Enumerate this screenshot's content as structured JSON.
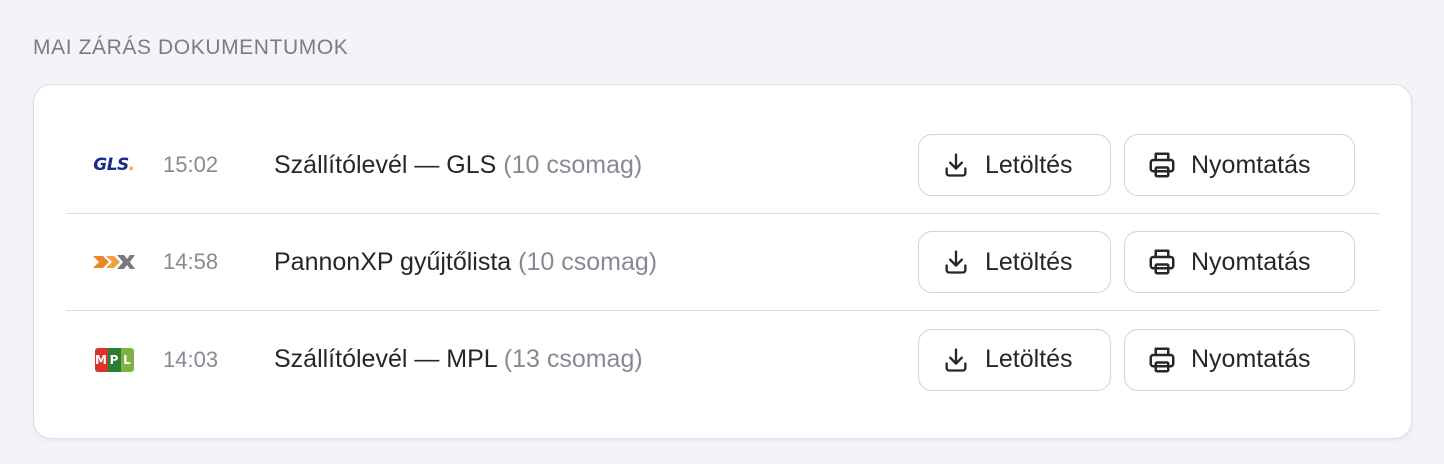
{
  "section": {
    "title": "MAI ZÁRÁS DOKUMENTUMOK"
  },
  "documents": [
    {
      "carrier": "GLS",
      "logo_text": "GLS",
      "logo_dot": ".",
      "time": "15:02",
      "title": "Szállítólevél — GLS",
      "count": "(10 csomag)",
      "download_label": "Letöltés",
      "print_label": "Nyomtatás"
    },
    {
      "carrier": "PannonXP",
      "time": "14:58",
      "title": "PannonXP gyűjtőlista",
      "count": "(10 csomag)",
      "download_label": "Letöltés",
      "print_label": "Nyomtatás"
    },
    {
      "carrier": "MPL",
      "logo_letters": [
        "M",
        "P",
        "L"
      ],
      "time": "14:03",
      "title": "Szállítólevél — MPL",
      "count": "(13 csomag)",
      "download_label": "Letöltés",
      "print_label": "Nyomtatás"
    }
  ],
  "icons": {
    "download": "download-icon",
    "print": "printer-icon"
  },
  "colors": {
    "gls_blue": "#1a2a8c",
    "gls_yellow": "#f2b705",
    "pannon_orange": "#e8862a",
    "pannon_gray": "#8c8c8c",
    "mpl_red": "#d9342b",
    "mpl_green_dark": "#2e7d32",
    "mpl_green_light": "#7cb342"
  }
}
